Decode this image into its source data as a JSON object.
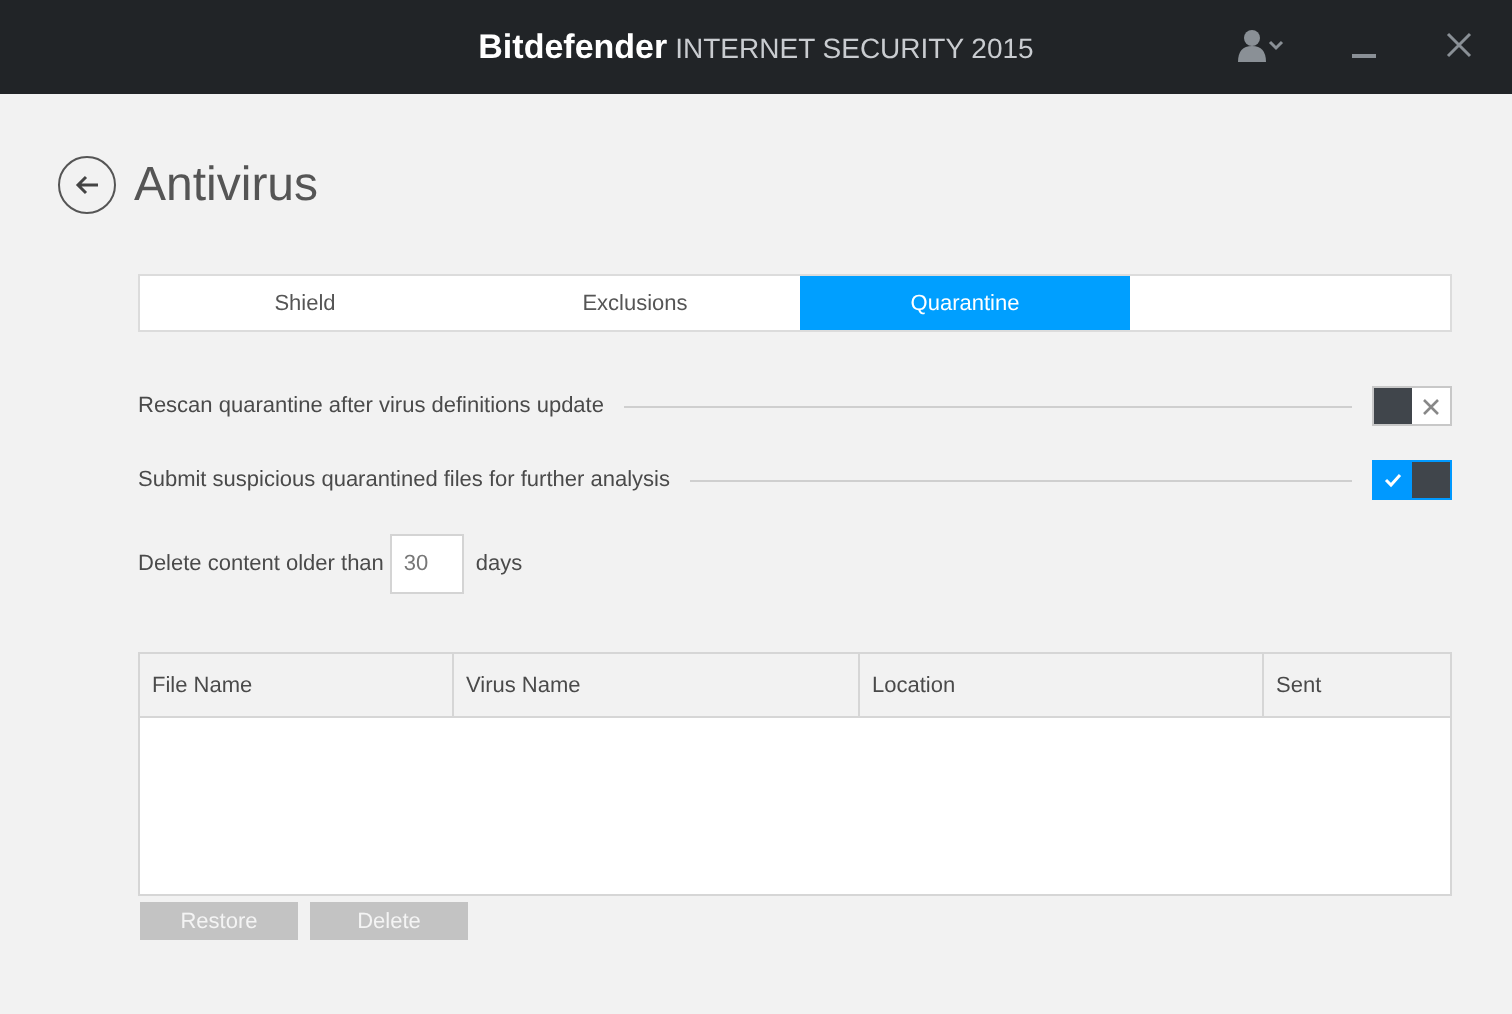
{
  "window": {
    "brand": "Bitdefender",
    "product": "INTERNET SECURITY 2015"
  },
  "page": {
    "title": "Antivirus"
  },
  "tabs": [
    {
      "label": "Shield",
      "selected": false
    },
    {
      "label": "Exclusions",
      "selected": false
    },
    {
      "label": "Quarantine",
      "selected": true
    }
  ],
  "settings": [
    {
      "label": "Rescan quarantine after virus definitions update",
      "on": false
    },
    {
      "label": "Submit suspicious quarantined files for further analysis",
      "on": true
    }
  ],
  "delete_older": {
    "label": "Delete content older than",
    "value": "30",
    "unit": "days"
  },
  "table": {
    "columns": [
      "File Name",
      "Virus Name",
      "Location",
      "Sent"
    ]
  },
  "buttons": [
    {
      "label": "Restore",
      "disabled": true
    },
    {
      "label": "Delete",
      "disabled": true
    }
  ]
}
